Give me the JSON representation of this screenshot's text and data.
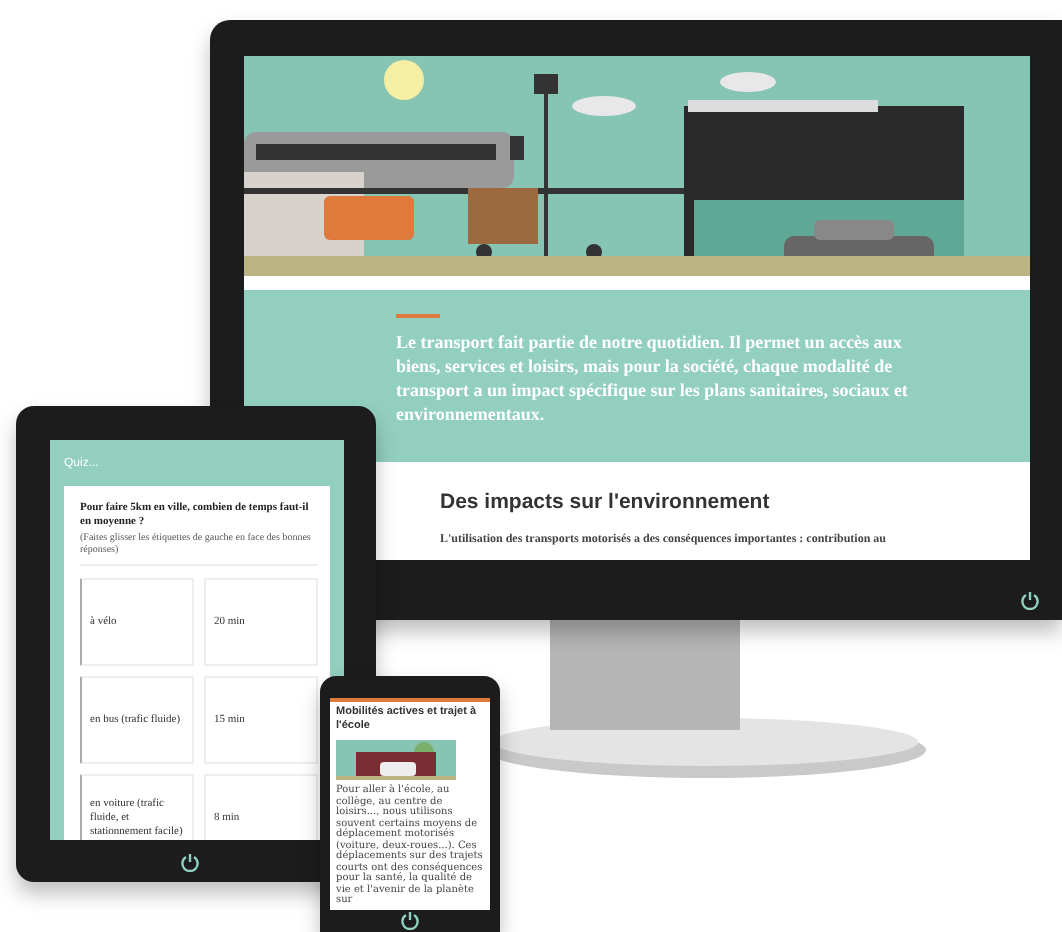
{
  "monitor": {
    "lead": "Le transport fait partie de notre quotidien. Il permet un accès aux biens, services et loisirs, mais pour la société, chaque modalité de transport a un impact spécifique sur les plans sanitaires, sociaux et environnementaux.",
    "heading": "Des impacts sur l'environnement",
    "paragraph": "L'utilisation des transports motorisés a des conséquences importantes : contribution au"
  },
  "tablet": {
    "header": "Quiz...",
    "question": "Pour faire 5km en ville, combien de temps faut-il en moyenne ?",
    "instruction": "(Faites glisser les étiquettes de gauche en face des bonnes réponses)",
    "pairs": [
      {
        "left": "à vélo",
        "right": "20 min"
      },
      {
        "left": "en bus (trafic fluide)",
        "right": "15 min"
      },
      {
        "left": "en voiture (trafic fluide, et stationnement facile)",
        "right": "8 min"
      }
    ]
  },
  "phone": {
    "title": "Mobilités actives et trajet à l'école",
    "paragraph": "Pour aller à l'école, au collège, au centre de loisirs..., nous utilisons souvent certains moyens de déplacement motorisés (voiture, deux-roues...). Ces déplacements sur des trajets courts ont des conséquences pour la santé, la qualité de vie et l'avenir de la planète sur"
  }
}
